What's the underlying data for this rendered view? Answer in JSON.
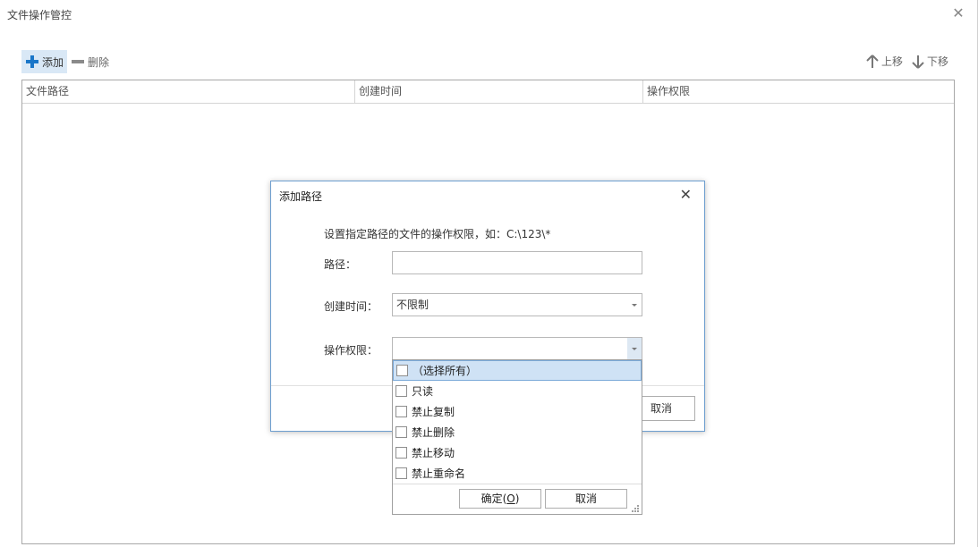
{
  "window": {
    "title": "文件操作管控",
    "close_glyph": "✕"
  },
  "toolbar": {
    "add_label": "添加",
    "delete_label": "删除",
    "move_up_label": "上移",
    "move_down_label": "下移"
  },
  "table": {
    "columns": [
      "文件路径",
      "创建时间",
      "操作权限"
    ],
    "rows": []
  },
  "dialog": {
    "title": "添加路径",
    "close_glyph": "✕",
    "hint": "设置指定路径的文件的操作权限，如：C:\\123\\*",
    "path_label": "路径：",
    "path_value": "",
    "created_label": "创建时间：",
    "created_value": "不限制",
    "permission_label": "操作权限：",
    "permission_value": "",
    "cancel_label": "取消"
  },
  "dropdown": {
    "items": [
      "（选择所有）",
      "只读",
      "禁止复制",
      "禁止删除",
      "禁止移动",
      "禁止重命名"
    ],
    "ok_label": "确定(O)",
    "ok_mnemonic": "O",
    "cancel_label": "取消"
  },
  "colors": {
    "accent": "#1a76c8",
    "highlight": "#cfe2f5",
    "dialog_border": "#6d9ecf"
  }
}
